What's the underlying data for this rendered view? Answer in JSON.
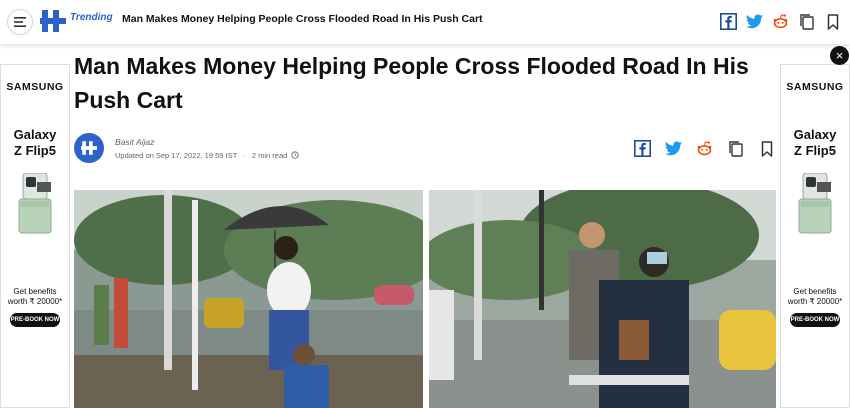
{
  "header": {
    "section_label": "Trending",
    "headline": "Man Makes Money Helping People Cross Flooded Road In His Push Cart",
    "icons": [
      "menu-icon",
      "site-logo",
      "facebook-icon",
      "twitter-icon",
      "reddit-icon",
      "copy-icon",
      "bookmark-icon"
    ]
  },
  "ads": {
    "brand": "SAMSUNG",
    "model_line1": "Galaxy",
    "model_line2": "Z Flip5",
    "offer_line1": "Get benefits",
    "offer_line2": "worth ₹ 20000*",
    "cta": "PRE-BOOK NOW"
  },
  "article": {
    "title": "Man Makes Money Helping People Cross Flooded Road In His Push Cart",
    "author": "Basit Aijaz",
    "updated": "Updated on Sep 17, 2022, 19:59 IST",
    "separator": "·",
    "read_time": "2 min read"
  },
  "colors": {
    "accent": "#2c62c9",
    "facebook": "#1d4e9b",
    "twitter": "#1d9bf0",
    "reddit": "#ff4500"
  }
}
